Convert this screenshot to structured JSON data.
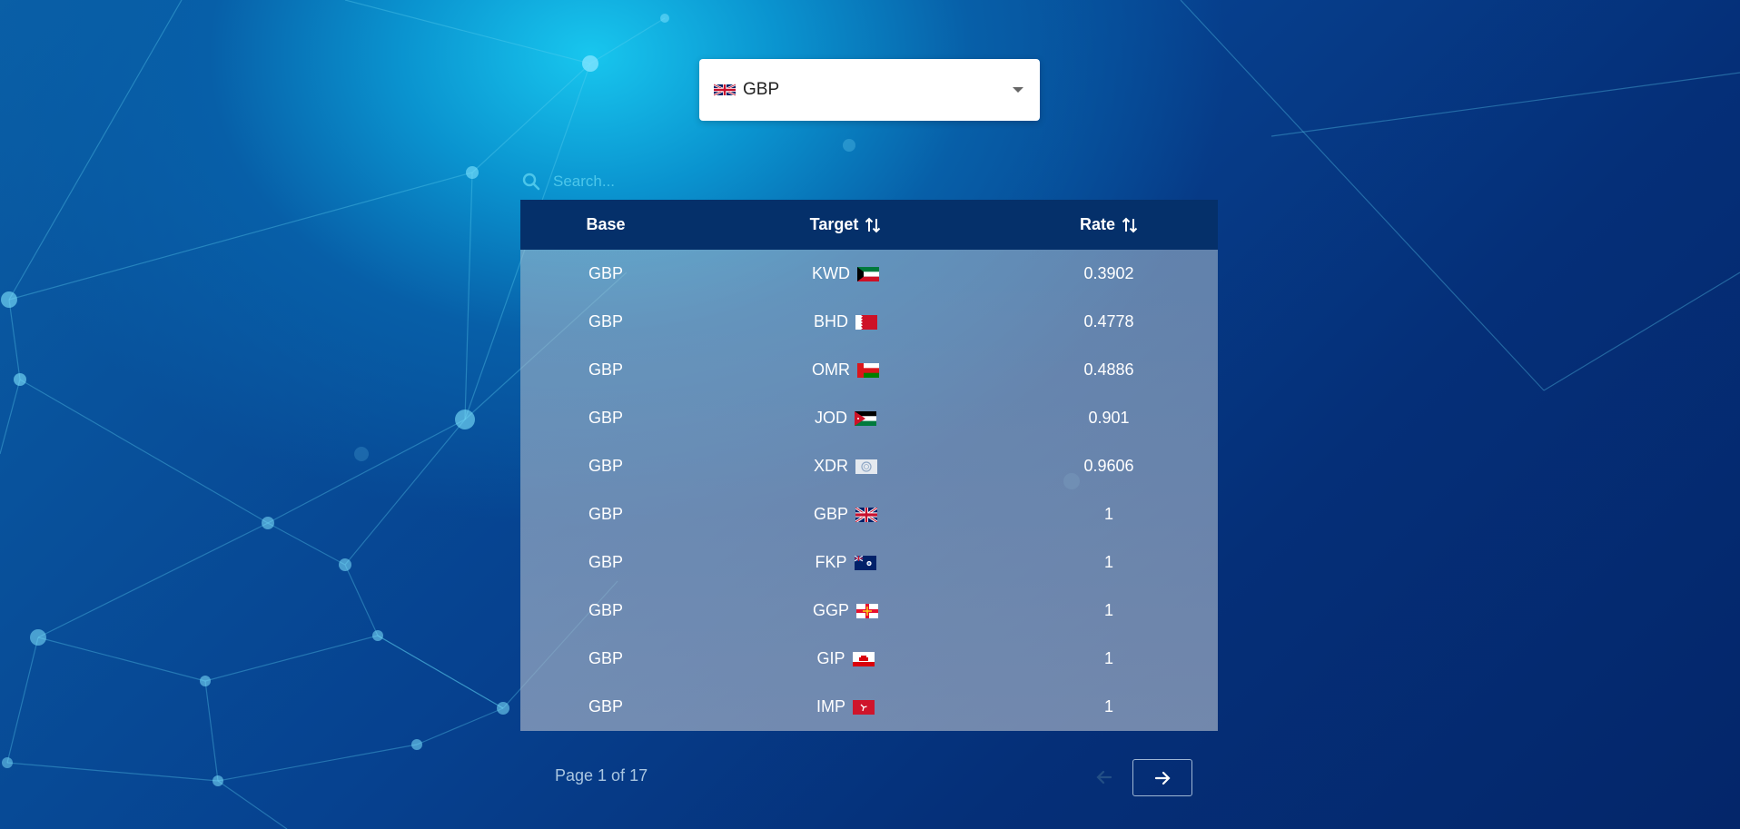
{
  "currency_select": {
    "selected": "GBP",
    "flag": "gb-flag-icon"
  },
  "search": {
    "placeholder": "Search..."
  },
  "table": {
    "headers": {
      "base": "Base",
      "target": "Target",
      "rate": "Rate"
    },
    "rows": [
      {
        "base": "GBP",
        "target": "KWD",
        "flag": "kw-flag-icon",
        "rate": "0.3902"
      },
      {
        "base": "GBP",
        "target": "BHD",
        "flag": "bh-flag-icon",
        "rate": "0.4778"
      },
      {
        "base": "GBP",
        "target": "OMR",
        "flag": "om-flag-icon",
        "rate": "0.4886"
      },
      {
        "base": "GBP",
        "target": "JOD",
        "flag": "jo-flag-icon",
        "rate": "0.901"
      },
      {
        "base": "GBP",
        "target": "XDR",
        "flag": "imf-flag-icon",
        "rate": "0.9606"
      },
      {
        "base": "GBP",
        "target": "GBP",
        "flag": "gb-flag-icon",
        "rate": "1"
      },
      {
        "base": "GBP",
        "target": "FKP",
        "flag": "fk-flag-icon",
        "rate": "1"
      },
      {
        "base": "GBP",
        "target": "GGP",
        "flag": "gg-flag-icon",
        "rate": "1"
      },
      {
        "base": "GBP",
        "target": "GIP",
        "flag": "gi-flag-icon",
        "rate": "1"
      },
      {
        "base": "GBP",
        "target": "IMP",
        "flag": "im-flag-icon",
        "rate": "1"
      }
    ]
  },
  "pagination": {
    "label": "Page 1 of 17"
  },
  "colors": {
    "header": "#05306a",
    "accent": "#4cc6ea"
  }
}
